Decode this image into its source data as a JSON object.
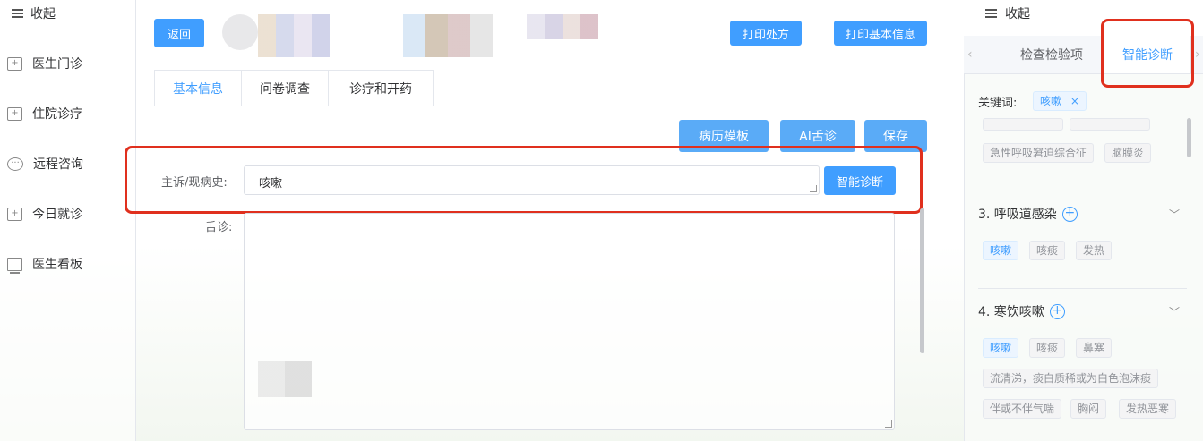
{
  "sidebar": {
    "collapse_label": "收起",
    "items": [
      {
        "label": "医生门诊",
        "icon": "calendar-icon"
      },
      {
        "label": "住院诊疗",
        "icon": "calendar-icon"
      },
      {
        "label": "远程咨询",
        "icon": "chat-bubble-icon"
      },
      {
        "label": "今日就诊",
        "icon": "calendar-icon"
      },
      {
        "label": "医生看板",
        "icon": "monitor-icon"
      }
    ]
  },
  "toolbar": {
    "back_label": "返回",
    "print_prescription_label": "打印处方",
    "print_basic_info_label": "打印基本信息"
  },
  "tabs": [
    {
      "label": "基本信息",
      "active": true
    },
    {
      "label": "问卷调查",
      "active": false
    },
    {
      "label": "诊疗和开药",
      "active": false
    }
  ],
  "actions": {
    "template_label": "病历模板",
    "ai_tongue_label": "AI舌诊",
    "save_label": "保存"
  },
  "form": {
    "complaint_label": "主诉/现病史:",
    "complaint_value": "咳嗽",
    "diagnose_button_label": "智能诊断",
    "tongue_label": "舌诊:"
  },
  "right_panel": {
    "collapse_label": "收起",
    "tabs": [
      {
        "label": "检查检验项",
        "active": false
      },
      {
        "label": "智能诊断",
        "active": true
      }
    ],
    "keyword_label": "关键词:",
    "keyword_tag": "咳嗽",
    "group2_tags": [
      "急性呼吸窘迫综合征",
      "脑膜炎"
    ],
    "group3": {
      "title": "3. 呼吸道感染",
      "tags": [
        "咳嗽",
        "咳痰",
        "发热"
      ]
    },
    "group4": {
      "title": "4. 寒饮咳嗽",
      "tags": [
        "咳嗽",
        "咳痰",
        "鼻塞",
        "流清涕，痰白质稀或为白色泡沫痰",
        "伴或不伴气喘",
        "胸闷",
        "发热恶寒"
      ]
    }
  },
  "colors": {
    "accent": "#409eff",
    "highlight_box": "#e0301e"
  }
}
